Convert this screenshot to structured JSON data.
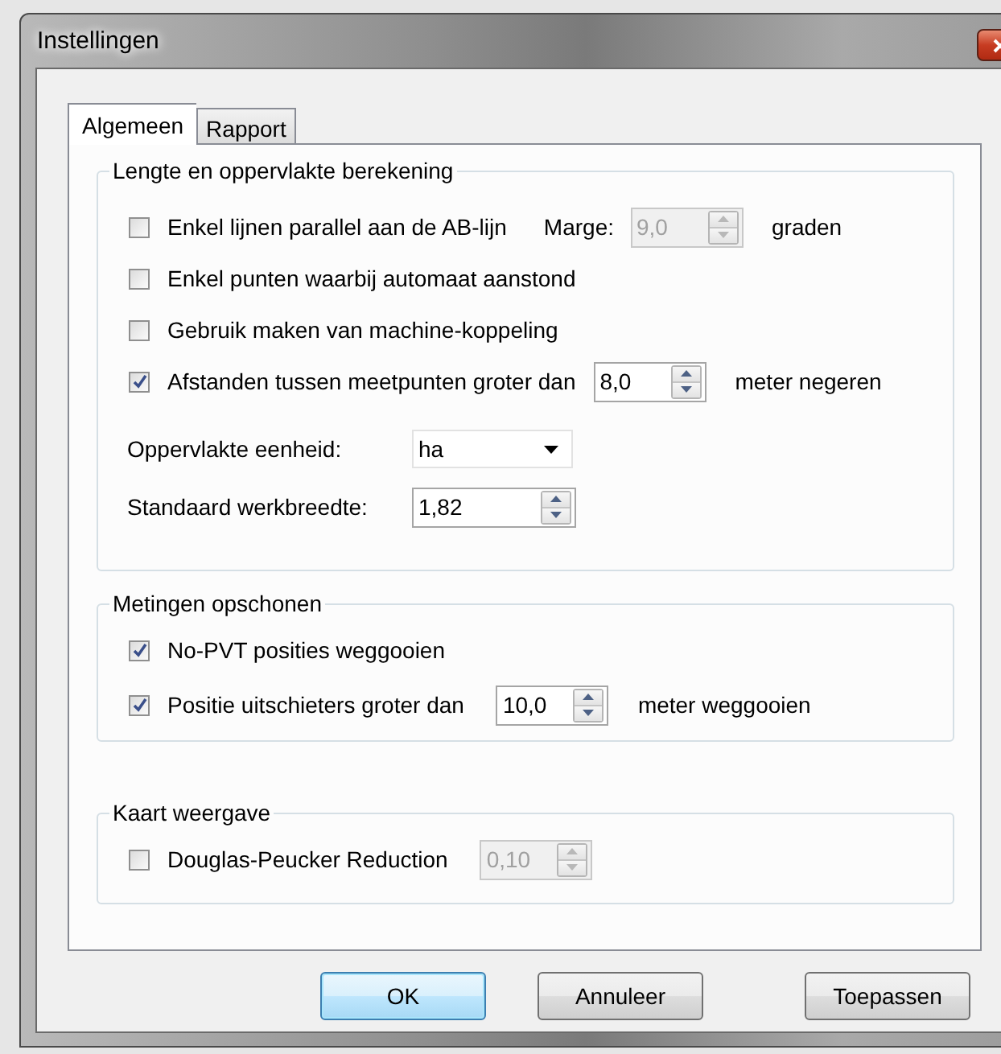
{
  "window": {
    "title": "Instellingen"
  },
  "tabs": [
    {
      "label": "Algemeen",
      "selected": true
    },
    {
      "label": "Rapport",
      "selected": false
    }
  ],
  "groups": [
    {
      "title": "Lengte en oppervlakte berekening",
      "rows": [
        {
          "kind": "check",
          "label": "Enkel lijnen parallel aan de AB-lijn",
          "checked": false,
          "extra_label": "Marge:",
          "spin": {
            "value": "9,0",
            "disabled": true
          },
          "unit": "graden"
        },
        {
          "kind": "check",
          "label": "Enkel punten waarbij automaat aanstond",
          "checked": false
        },
        {
          "kind": "check",
          "label": "Gebruik maken van machine-koppeling",
          "checked": false
        },
        {
          "kind": "check",
          "label": "Afstanden tussen meetpunten groter dan",
          "checked": true,
          "spin": {
            "value": "8,0",
            "disabled": false
          },
          "unit": "meter negeren"
        },
        {
          "kind": "select",
          "label": "Oppervlakte eenheid:",
          "value": "ha"
        },
        {
          "kind": "spin",
          "label": "Standaard werkbreedte:",
          "spin": {
            "value": "1,82",
            "disabled": false
          }
        }
      ]
    },
    {
      "title": "Metingen opschonen",
      "rows": [
        {
          "kind": "check",
          "label": "No-PVT posities weggooien",
          "checked": true
        },
        {
          "kind": "check",
          "label": "Positie uitschieters groter dan",
          "checked": true,
          "spin": {
            "value": "10,0",
            "disabled": false
          },
          "unit": "meter weggooien"
        }
      ]
    },
    {
      "title": "Kaart weergave",
      "rows": [
        {
          "kind": "check",
          "label": "Douglas-Peucker Reduction",
          "checked": false,
          "spin": {
            "value": "0,10",
            "disabled": true
          }
        }
      ]
    }
  ],
  "buttons": [
    {
      "label": "OK",
      "default": true
    },
    {
      "label": "Annuleer",
      "default": false
    },
    {
      "label": "Toepassen",
      "default": false
    }
  ]
}
